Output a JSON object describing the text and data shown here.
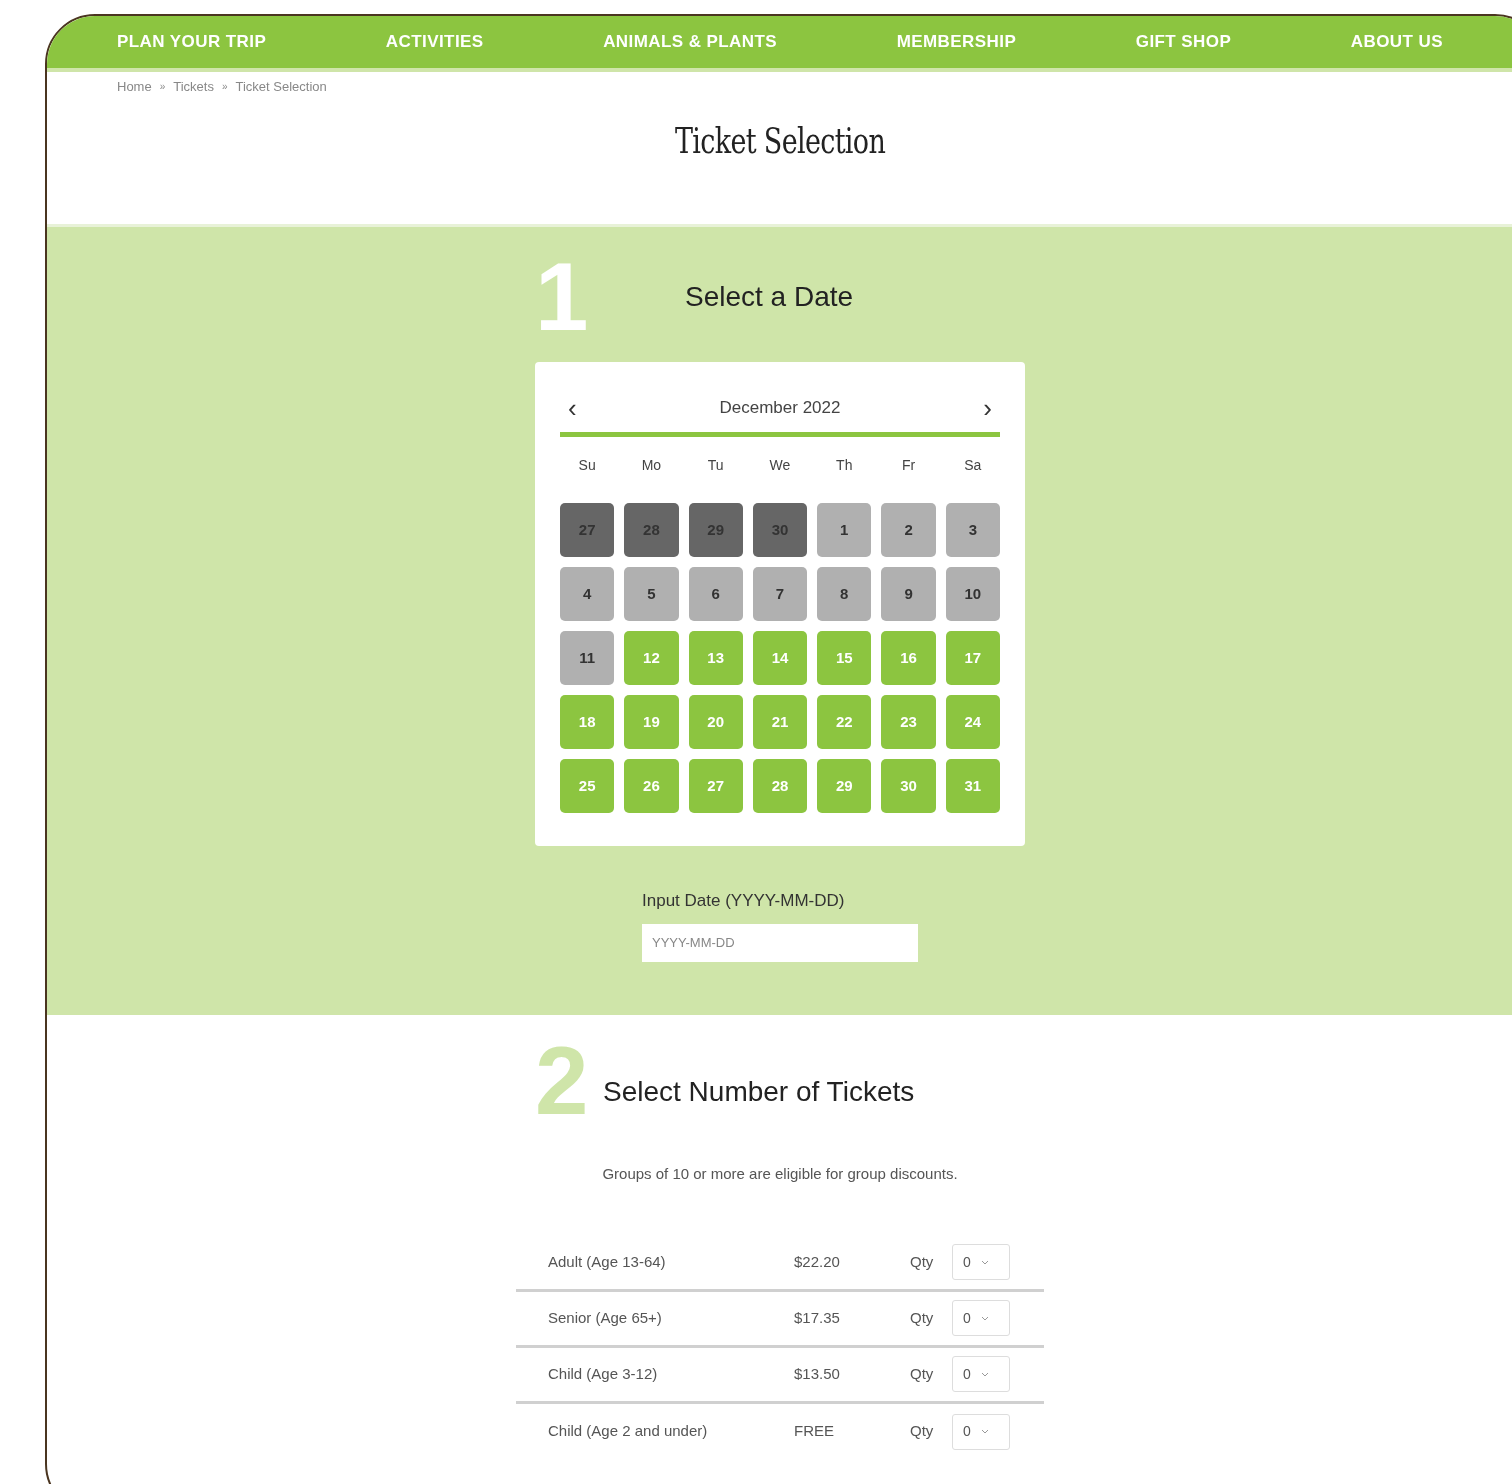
{
  "nav": [
    {
      "label": "PLAN YOUR TRIP"
    },
    {
      "label": "ACTIVITIES"
    },
    {
      "label": "ANIMALS & PLANTS"
    },
    {
      "label": "MEMBERSHIP"
    },
    {
      "label": "GIFT SHOP"
    },
    {
      "label": "ABOUT US"
    }
  ],
  "breadcrumb": [
    "Home",
    "Tickets",
    "Ticket Selection"
  ],
  "breadcrumb_separator": "»",
  "title": "Ticket Selection",
  "step1": {
    "number": "1",
    "heading": "Select a Date",
    "calendar": {
      "prev": "‹",
      "month": "December 2022",
      "next": "›",
      "weekdays": [
        "Su",
        "Mo",
        "Tu",
        "We",
        "Th",
        "Fr",
        "Sa"
      ],
      "days": [
        {
          "label": "27",
          "kind": "outside"
        },
        {
          "label": "28",
          "kind": "outside"
        },
        {
          "label": "29",
          "kind": "outside"
        },
        {
          "label": "30",
          "kind": "outside"
        },
        {
          "label": "1",
          "kind": "unavailable"
        },
        {
          "label": "2",
          "kind": "unavailable"
        },
        {
          "label": "3",
          "kind": "unavailable"
        },
        {
          "label": "4",
          "kind": "unavailable"
        },
        {
          "label": "5",
          "kind": "unavailable"
        },
        {
          "label": "6",
          "kind": "unavailable"
        },
        {
          "label": "7",
          "kind": "unavailable"
        },
        {
          "label": "8",
          "kind": "unavailable"
        },
        {
          "label": "9",
          "kind": "unavailable"
        },
        {
          "label": "10",
          "kind": "unavailable"
        },
        {
          "label": "11",
          "kind": "unavailable"
        },
        {
          "label": "12",
          "kind": "available"
        },
        {
          "label": "13",
          "kind": "available"
        },
        {
          "label": "14",
          "kind": "available"
        },
        {
          "label": "15",
          "kind": "available"
        },
        {
          "label": "16",
          "kind": "available"
        },
        {
          "label": "17",
          "kind": "available"
        },
        {
          "label": "18",
          "kind": "available"
        },
        {
          "label": "19",
          "kind": "available"
        },
        {
          "label": "20",
          "kind": "available"
        },
        {
          "label": "21",
          "kind": "available"
        },
        {
          "label": "22",
          "kind": "available"
        },
        {
          "label": "23",
          "kind": "available"
        },
        {
          "label": "24",
          "kind": "available"
        },
        {
          "label": "25",
          "kind": "available"
        },
        {
          "label": "26",
          "kind": "available"
        },
        {
          "label": "27",
          "kind": "available"
        },
        {
          "label": "28",
          "kind": "available"
        },
        {
          "label": "29",
          "kind": "available"
        },
        {
          "label": "30",
          "kind": "available"
        },
        {
          "label": "31",
          "kind": "available"
        }
      ]
    },
    "date_input": {
      "label": "Input Date (YYYY-MM-DD)",
      "placeholder": "YYYY-MM-DD"
    }
  },
  "step2": {
    "number": "2",
    "heading": "Select Number of Tickets",
    "note": "Groups of 10 or more are eligible for group discounts.",
    "tickets": [
      {
        "name": "Adult (Age 13-64)",
        "price": "$22.20",
        "qty_label": "Qty",
        "qty": "0"
      },
      {
        "name": "Senior (Age 65+)",
        "price": "$17.35",
        "qty_label": "Qty",
        "qty": "0"
      },
      {
        "name": "Child (Age 3-12)",
        "price": "$13.50",
        "qty_label": "Qty",
        "qty": "0"
      },
      {
        "name": "Child (Age 2 and under)",
        "price": "FREE",
        "qty_label": "Qty",
        "qty": "0"
      }
    ]
  }
}
